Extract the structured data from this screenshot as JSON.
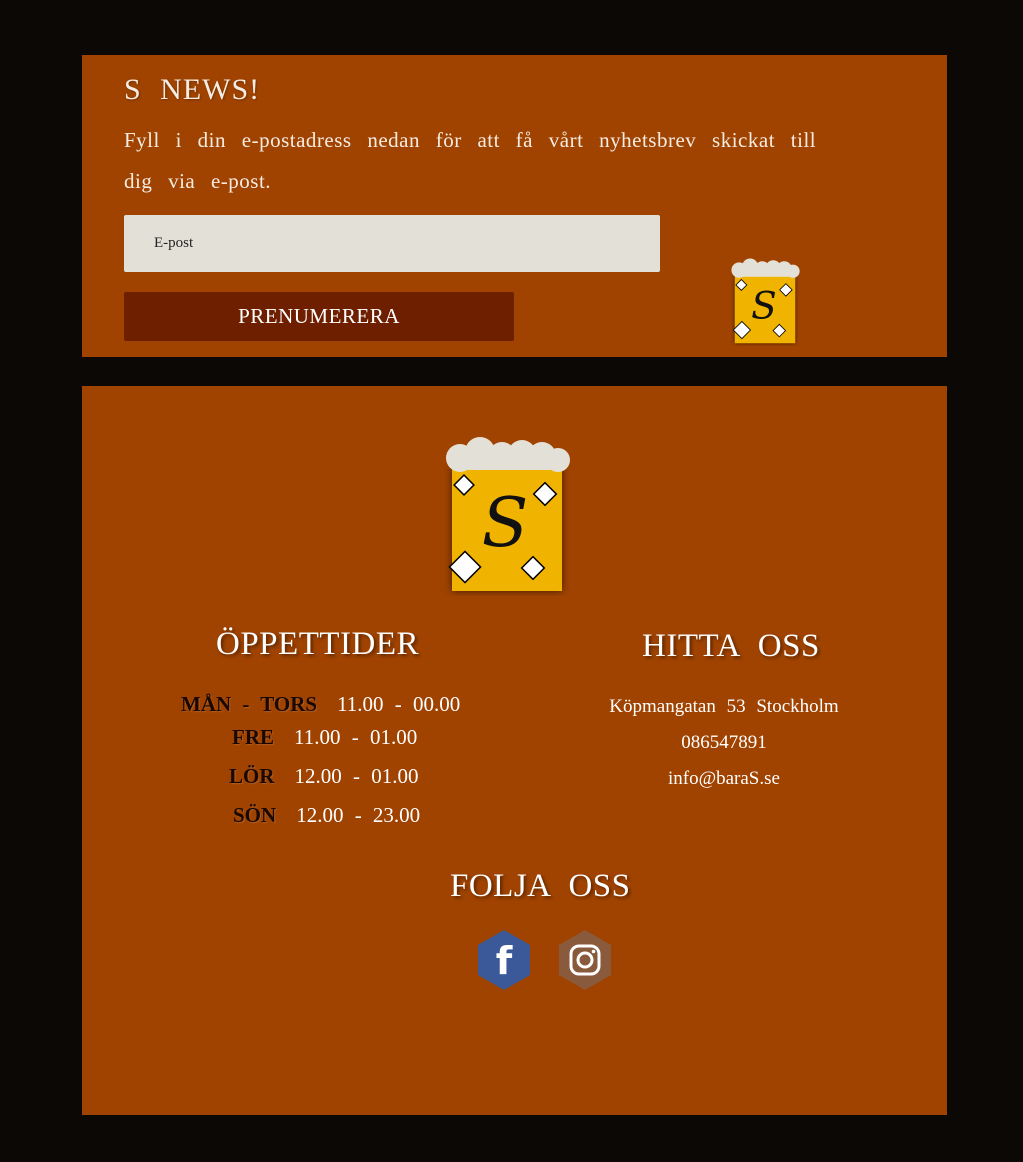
{
  "newsletter": {
    "title": "S NEWS!",
    "text": "Fyll i din e-postadress nedan för att få vårt nyhetsbrev skickat till dig via e-post.",
    "email_placeholder": "E-post",
    "subscribe_label": "PRENUMERERA"
  },
  "logo": {
    "letter": "S",
    "icon": "beer-mug-logo"
  },
  "hours": {
    "title": "ÖPPETTIDER",
    "rows": [
      {
        "day": "MÅN - TORS",
        "time": "11.00 - 00.00"
      },
      {
        "day": "FRE",
        "time": "11.00 - 01.00"
      },
      {
        "day": "LÖR",
        "time": "12.00 - 01.00"
      },
      {
        "day": "SÖN",
        "time": "12.00 - 23.00"
      }
    ]
  },
  "find_us": {
    "title": "HITTA OSS",
    "address": "Köpmangatan 53 Stockholm",
    "phone": "086547891",
    "email": "info@baraS.se"
  },
  "follow": {
    "title": "FOLJA OSS",
    "facebook_icon": "facebook-icon",
    "instagram_icon": "instagram-icon"
  },
  "colors": {
    "background": "#0c0806",
    "panel": "#a04300",
    "button": "#6e1f00",
    "input": "#e3e1d7",
    "logo_yellow": "#f0b400",
    "facebook": "#3b5998",
    "instagram": "#8a5a3c"
  }
}
